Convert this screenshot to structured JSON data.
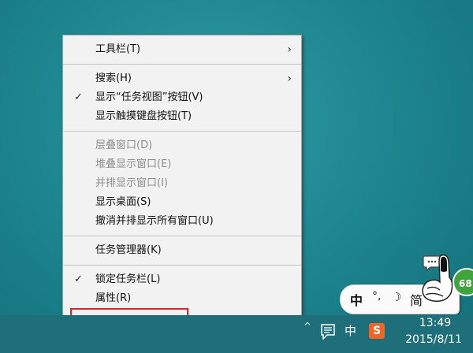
{
  "context_menu": {
    "items": [
      {
        "label": "工具栏(T)",
        "has_submenu": true
      },
      {
        "label": "搜索(H)",
        "has_submenu": true
      },
      {
        "label": "显示“任务视图”按钮(V)",
        "checked": true
      },
      {
        "label": "显示触摸键盘按钮(T)"
      },
      {
        "label": "层叠窗口(D)",
        "disabled": true
      },
      {
        "label": "堆叠显示窗口(E)",
        "disabled": true
      },
      {
        "label": "并排显示窗口(I)",
        "disabled": true
      },
      {
        "label": "显示桌面(S)"
      },
      {
        "label": "撤消并排显示所有窗口(U)"
      },
      {
        "label": "任务管理器(K)"
      },
      {
        "label": "锁定任务栏(L)",
        "checked": true
      },
      {
        "label": "属性(R)",
        "highlighted": true
      }
    ],
    "check_mark": "✓",
    "submenu_arrow": "›"
  },
  "ime_toolbar": {
    "mode": "中",
    "punct": "°,",
    "moon": "☽",
    "script": "简",
    "badge": "68"
  },
  "tray": {
    "expand_glyph": "^",
    "ime_label": "中",
    "sogou_label": "S"
  },
  "clock": {
    "time": "13:49",
    "date": "2015/8/11"
  },
  "colors": {
    "highlight_border": "#d9262a",
    "badge": "#3ea43b",
    "sogou": "#f26522"
  }
}
